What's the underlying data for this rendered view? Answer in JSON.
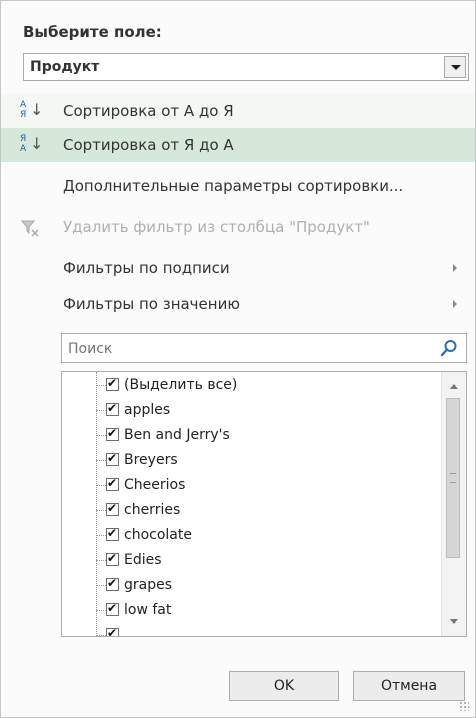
{
  "field": {
    "label": "Выберите поле:",
    "selected": "Продукт"
  },
  "menu": {
    "sort_asc": "Сортировка от А до Я",
    "sort_desc": "Сортировка от Я до А",
    "more_sort": "Дополнительные параметры сортировки...",
    "clear_filter": "Удалить фильтр из столбца \"Продукт\"",
    "label_filters": "Фильтры по подписи",
    "value_filters": "Фильтры по значению"
  },
  "search": {
    "placeholder": "Поиск"
  },
  "list": {
    "items": [
      {
        "label": "(Выделить все)",
        "checked": true
      },
      {
        "label": "apples",
        "checked": true
      },
      {
        "label": "Ben and Jerry's",
        "checked": true
      },
      {
        "label": "Breyers",
        "checked": true
      },
      {
        "label": "Cheerios",
        "checked": true
      },
      {
        "label": "cherries",
        "checked": true
      },
      {
        "label": "chocolate",
        "checked": true
      },
      {
        "label": "Edies",
        "checked": true
      },
      {
        "label": "grapes",
        "checked": true
      },
      {
        "label": "low fat",
        "checked": true
      }
    ]
  },
  "buttons": {
    "ok": "OK",
    "cancel": "Отмена"
  },
  "icons": {
    "sort_asc": "sort-a-to-z-icon",
    "sort_desc": "sort-z-to-a-icon",
    "clear_filter": "clear-filter-icon",
    "search": "search-icon",
    "dropdown": "chevron-down-icon"
  }
}
